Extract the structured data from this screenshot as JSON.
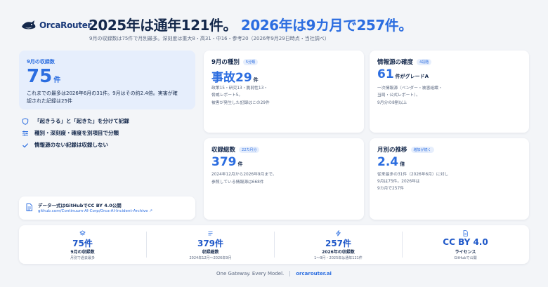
{
  "brand": {
    "name": "OrcaRouter",
    "accent": "#2b6de0",
    "dark": "#14284b"
  },
  "header": {
    "headline_a": "2025年は通年121件。",
    "headline_b": "2026年は9カ月で257件。",
    "subline": "9月の収録数は75件で月別最多。深刻度は重大8・高31・中16・参考20（2026年9月29日時点・当社調べ）"
  },
  "hero": {
    "label": "9月の収録数",
    "value": "75",
    "unit": "件",
    "desc_1": "これまでの最多は2026年6月の31件。9月はその約2.4倍。実害が確",
    "desc_2": "認された記録は25件"
  },
  "features": [
    {
      "icon": "shield-icon",
      "text": "「起きうる」と「起きた」を分けて記録"
    },
    {
      "icon": "sliders-icon",
      "text": "種別・深刻度・確度を別項目で分類"
    },
    {
      "icon": "check-icon",
      "text": "情報源のない記録は収録しない"
    }
  ],
  "github": {
    "title": "データ一式はGitHubでCC BY 4.0公開",
    "link": "github.com/Continuum-AI-Corp/Orca-AI-Incident-Archive ↗"
  },
  "cards": {
    "types": {
      "title": "9月の種別",
      "badge": "5分類",
      "value": "事故29",
      "unit": "件",
      "lines": [
        "政策15・研究13・脆弱性13・",
        "脅威レポート5。",
        "被害が発生した記録はこの29件"
      ]
    },
    "confidence": {
      "title": "情報源の確度",
      "badge": "4段階",
      "value": "61",
      "unit": "件がグレードA",
      "lines": [
        "一次情報源（ベンダー・被害組織・",
        "当局・公式レポート）。",
        "9月分の8割以上"
      ]
    },
    "total": {
      "title": "収録総数",
      "badge": "22カ月分",
      "value": "379",
      "unit": "件",
      "lines": [
        "2024年12月から2026年9月まで。",
        "参照している情報源は668件"
      ]
    },
    "trend": {
      "title": "月別の推移",
      "badge": "増加が続く",
      "value": "2.4",
      "unit": "倍",
      "lines": [
        "従来最多の31件（2026年6月）に対し",
        "9月は75件。2026年は",
        "9カ月で257件"
      ]
    }
  },
  "stats": [
    {
      "icon": "layers-icon",
      "value": "75件",
      "label": "9月の収録数",
      "note": "月別で過去最多"
    },
    {
      "icon": "list-icon",
      "value": "379件",
      "label": "収録総数",
      "note": "2024年12月〜2026年9月"
    },
    {
      "icon": "bolt-icon",
      "value": "257件",
      "label": "2026年の収録数",
      "note": "1〜9月・2025年は通年121件"
    },
    {
      "icon": "doc-icon",
      "value": "CC BY 4.0",
      "label": "ライセンス",
      "note": "GitHubで公開"
    }
  ],
  "footer": {
    "tagline": "One Gateway. Every Model.",
    "site": "orcarouter.ai"
  }
}
